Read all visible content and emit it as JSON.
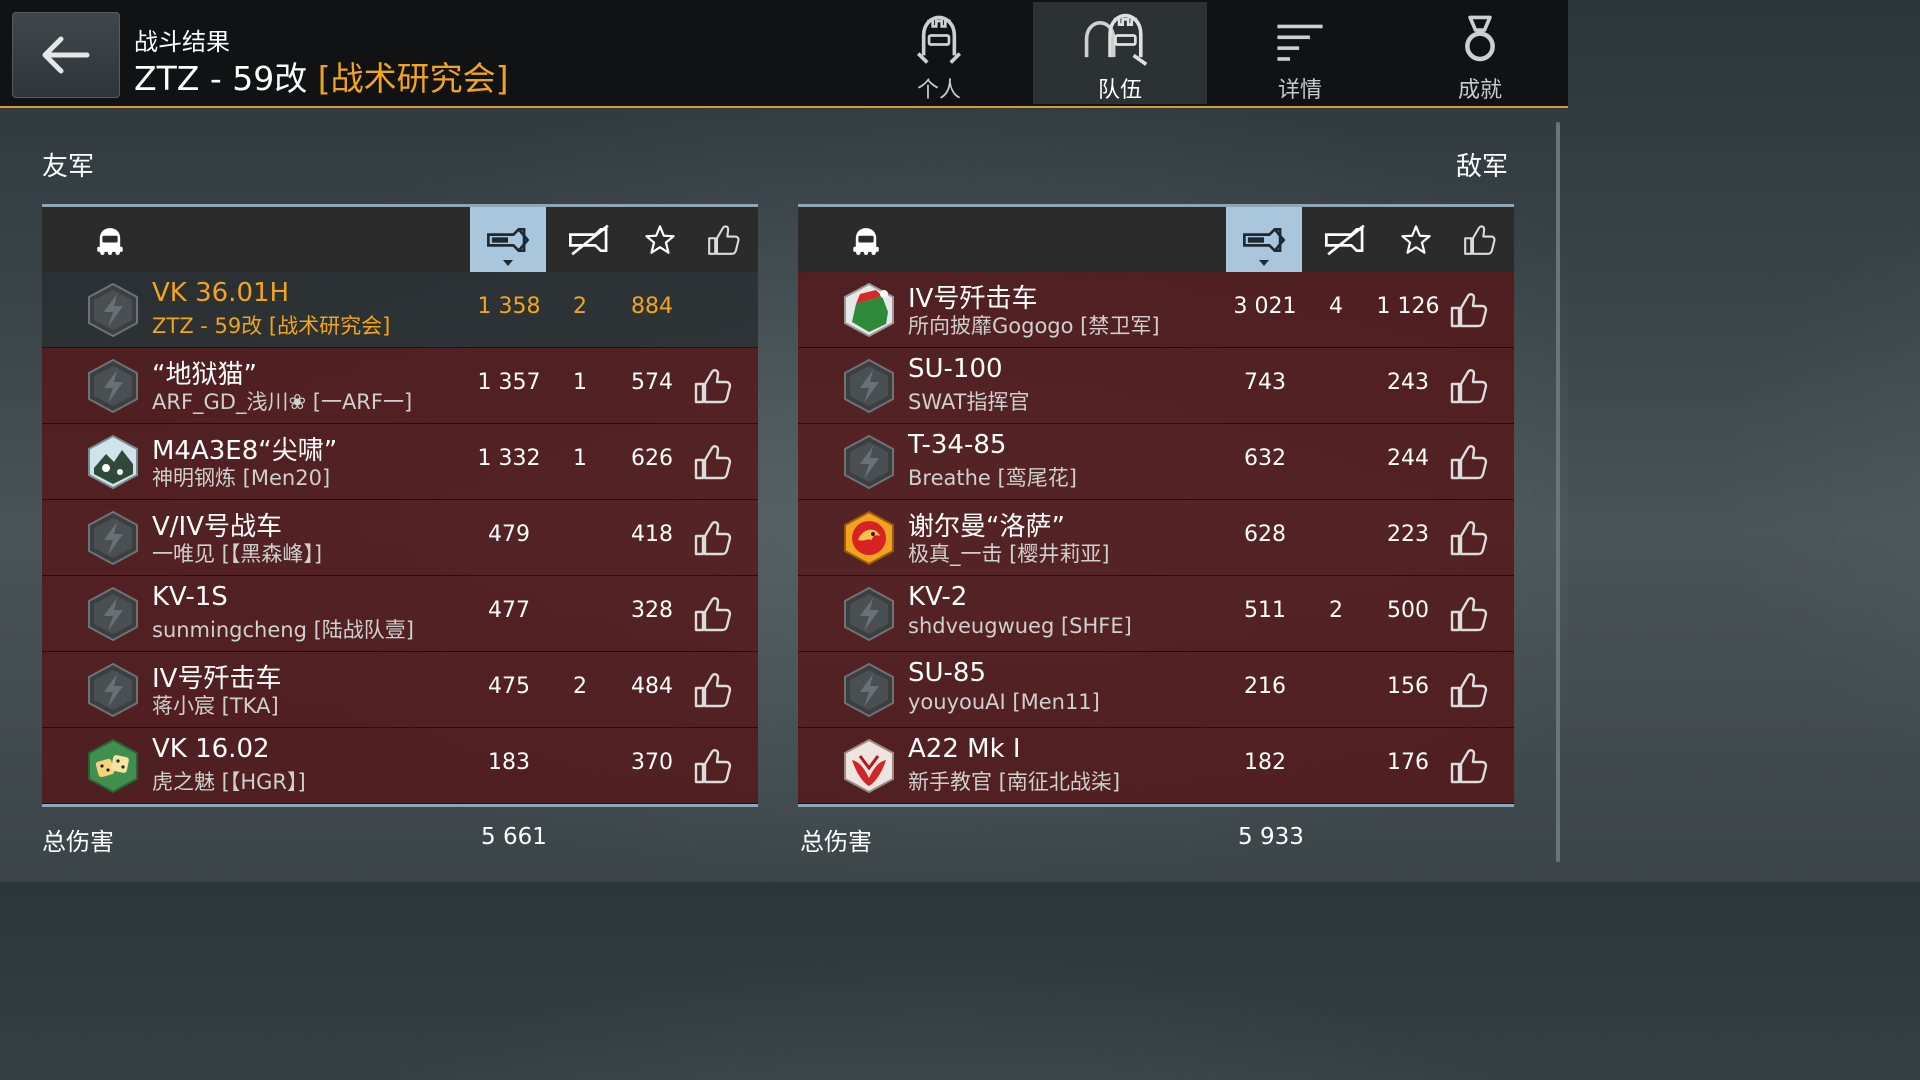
{
  "header": {
    "title_small": "战斗结果",
    "tank_name": "ZTZ - 59改",
    "clan_tag": "[战术研究会]"
  },
  "tabs": [
    {
      "label": "个人",
      "icon": "personal-helmet-icon",
      "active": false
    },
    {
      "label": "队伍",
      "icon": "team-helmets-icon",
      "active": true
    },
    {
      "label": "详情",
      "icon": "details-lines-icon",
      "active": false
    },
    {
      "label": "成就",
      "icon": "medal-icon",
      "active": false
    }
  ],
  "allies": {
    "label": "友军",
    "columns": [
      "tank-icon",
      "damage-icon",
      "kills-icon",
      "experience-star-icon",
      "like-icon"
    ],
    "sorted_column": "damage-icon",
    "rows": [
      {
        "tank": "VK 36.01H",
        "player": "ZTZ - 59改 [战术研究会]",
        "damage": "1 358",
        "kills": "2",
        "exp": "884",
        "self": true,
        "avatar": "default-bolt"
      },
      {
        "tank": "“地狱猫”",
        "player": "ARF_GD_浅川❀ [一ARF一]",
        "damage": "1 357",
        "kills": "1",
        "exp": "574",
        "self": false,
        "avatar": "default-bolt"
      },
      {
        "tank": "M4A3E8“尖啸”",
        "player": "神明钢炼 [Men20]",
        "damage": "1 332",
        "kills": "1",
        "exp": "626",
        "self": false,
        "avatar": "snow-camo"
      },
      {
        "tank": "V/IV号战车",
        "player": "一唯见 [【黑森峰】]",
        "damage": "479",
        "kills": "",
        "exp": "418",
        "self": false,
        "avatar": "default-bolt"
      },
      {
        "tank": "KV-1S",
        "player": "sunmingcheng [陆战队壹]",
        "damage": "477",
        "kills": "",
        "exp": "328",
        "self": false,
        "avatar": "default-bolt"
      },
      {
        "tank": "IV号歼击车",
        "player": "蒋小宸 [TKA]",
        "damage": "475",
        "kills": "2",
        "exp": "484",
        "self": false,
        "avatar": "default-bolt"
      },
      {
        "tank": "VK 16.02",
        "player": "虎之魅 [【HGR】]",
        "damage": "183",
        "kills": "",
        "exp": "370",
        "self": false,
        "avatar": "dice"
      }
    ],
    "total_label": "总伤害",
    "total_damage": "5 661"
  },
  "enemies": {
    "label": "敌军",
    "columns": [
      "tank-icon",
      "damage-icon",
      "kills-icon",
      "experience-star-icon",
      "like-icon"
    ],
    "sorted_column": "damage-icon",
    "rows": [
      {
        "tank": "IV号歼击车",
        "player": "所向披靡Gogogo [禁卫军]",
        "damage": "3 021",
        "kills": "4",
        "exp": "1 126",
        "avatar": "christmas"
      },
      {
        "tank": "SU-100",
        "player": "SWAT指挥官",
        "damage": "743",
        "kills": "",
        "exp": "243",
        "avatar": "default-bolt"
      },
      {
        "tank": "T-34-85",
        "player": "Breathe [鸾尾花]",
        "damage": "632",
        "kills": "",
        "exp": "244",
        "avatar": "default-bolt"
      },
      {
        "tank": "谢尔曼“洛萨”",
        "player": "极真_一击 [樱井莉亚]",
        "damage": "628",
        "kills": "",
        "exp": "223",
        "avatar": "dragon"
      },
      {
        "tank": "KV-2",
        "player": "shdveugwueg [SHFE]",
        "damage": "511",
        "kills": "2",
        "exp": "500",
        "avatar": "default-bolt"
      },
      {
        "tank": "SU-85",
        "player": "youyouAI [Men11]",
        "damage": "216",
        "kills": "",
        "exp": "156",
        "avatar": "default-bolt"
      },
      {
        "tank": "A22 Mk I",
        "player": "新手教官 [南征北战柒]",
        "damage": "182",
        "kills": "",
        "exp": "176",
        "avatar": "red-wings"
      }
    ],
    "total_label": "总伤害",
    "total_damage": "5 933"
  },
  "colors": {
    "accent": "#f2a51a",
    "row_bg": "#541618",
    "sort_highlight": "#a9c6dc",
    "header_line": "#d89a32"
  }
}
